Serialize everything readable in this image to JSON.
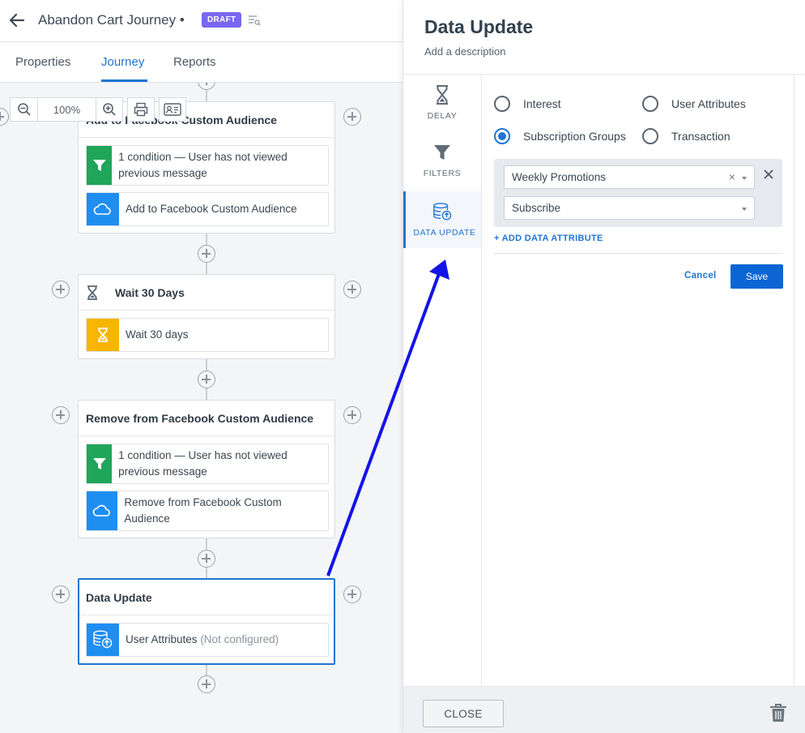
{
  "header": {
    "title": "Abandon Cart Journey",
    "title_suffix": " •",
    "badge": "DRAFT"
  },
  "tabs": [
    {
      "label": "Properties"
    },
    {
      "label": "Journey",
      "active": true
    },
    {
      "label": "Reports"
    }
  ],
  "zoom": {
    "level": "100%"
  },
  "cards": [
    {
      "title": "Add to Facebook Custom Audience",
      "steps": [
        {
          "icon": "filter-icon",
          "color": "#1fa65a",
          "text": "1 condition — User has not viewed previous message"
        },
        {
          "icon": "cloud-icon",
          "color": "#1f8ef1",
          "text": "Add to Facebook Custom Audience"
        }
      ]
    },
    {
      "title": "Wait 30 Days",
      "steps": [
        {
          "icon": "hourglass-icon",
          "color": "#f7b500",
          "text": "Wait 30 days"
        }
      ]
    },
    {
      "title": "Remove from Facebook Custom Audience",
      "steps": [
        {
          "icon": "filter-icon",
          "color": "#1fa65a",
          "text": "1 condition — User has not viewed previous message"
        },
        {
          "icon": "cloud-icon",
          "color": "#1f8ef1",
          "text": "Remove from Facebook Custom Audience"
        }
      ]
    },
    {
      "title": "Data Update",
      "steps": [
        {
          "icon": "database-upload-icon",
          "color": "#1f8ef1",
          "text": "User Attributes",
          "muted": "(Not configured)"
        }
      ]
    }
  ],
  "panel": {
    "title": "Data Update",
    "description": "Add a description",
    "side_items": [
      {
        "label": "DELAY",
        "icon": "hourglass-icon"
      },
      {
        "label": "FILTERS",
        "icon": "filter-icon"
      },
      {
        "label": "DATA UPDATE",
        "icon": "database-upload-icon",
        "active": true
      }
    ],
    "radios": [
      {
        "label": "Interest",
        "checked": false
      },
      {
        "label": "User Attributes",
        "checked": false
      },
      {
        "label": "Subscription Groups",
        "checked": true
      },
      {
        "label": "Transaction",
        "checked": false
      }
    ],
    "group_select": {
      "value": "Weekly Promotions",
      "clear": "×"
    },
    "action_select": {
      "value": "Subscribe"
    },
    "add_attribute": "+ ADD DATA ATTRIBUTE",
    "cancel": "Cancel",
    "save": "Save",
    "close": "CLOSE"
  },
  "colors": {
    "accent": "#1f76d3",
    "badge": "#7a67f0",
    "annotation_arrow": "#1414e6"
  }
}
